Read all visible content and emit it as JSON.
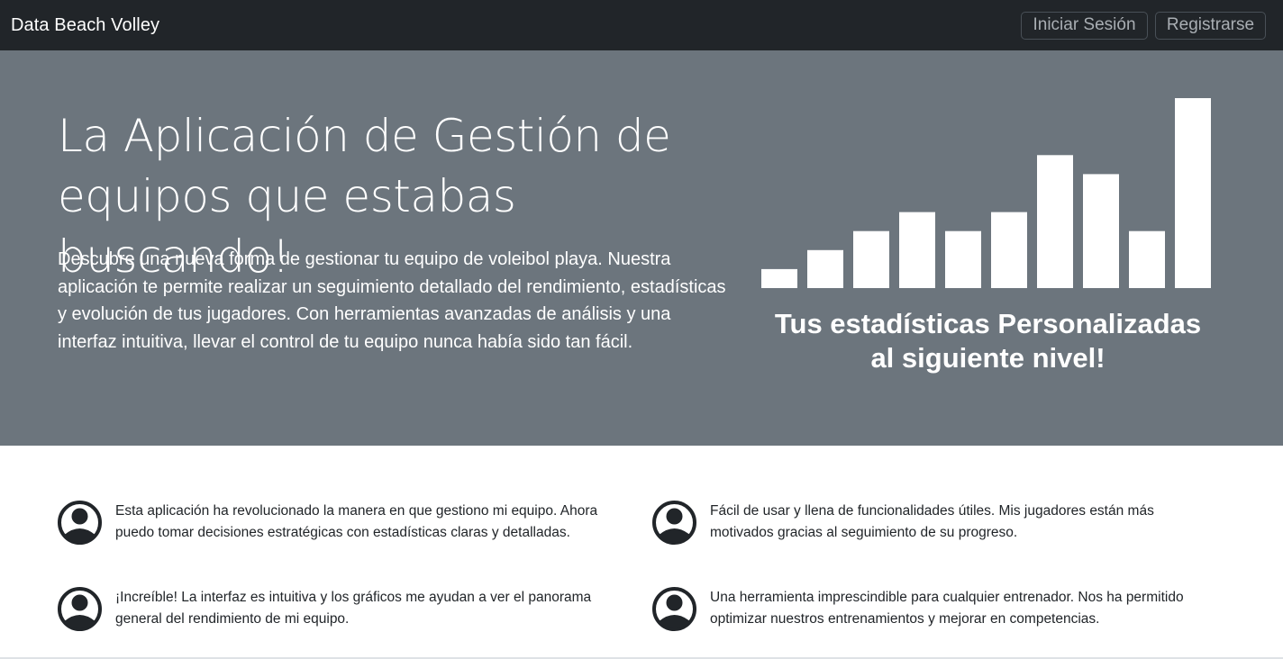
{
  "navbar": {
    "brand": "Data Beach Volley",
    "login_label": "Iniciar Sesión",
    "register_label": "Registrarse"
  },
  "hero": {
    "title": "La Aplicación de Gestión de equipos que estabas buscando!",
    "description": "Descubre una nueva forma de gestionar tu equipo de voleibol playa. Nuestra aplicación te permite realizar un seguimiento detallado del rendimiento, estadísticas y evolución de tus jugadores. Con herramientas avanzadas de análisis y una interfaz intuitiva, llevar el control de tu equipo nunca había sido tan fácil.",
    "chart_caption": "Tus estadísticas Personalizadas al siguiente nivel!"
  },
  "chart_data": {
    "type": "bar",
    "values": [
      1,
      2,
      3,
      4,
      3,
      4,
      7,
      6,
      3,
      10
    ],
    "ylim": [
      0,
      10
    ],
    "grid": false,
    "bar_color": "#ffffff"
  },
  "testimonials": [
    {
      "icon": "user-avatar-icon",
      "text": "Esta aplicación ha revolucionado la manera en que gestiono mi equipo. Ahora puedo tomar decisiones estratégicas con estadísticas claras y detalladas."
    },
    {
      "icon": "user-avatar-icon",
      "text": "Fácil de usar y llena de funcionalidades útiles. Mis jugadores están más motivados gracias al seguimiento de su progreso."
    },
    {
      "icon": "user-avatar-icon",
      "text": "¡Increíble! La interfaz es intuitiva y los gráficos me ayudan a ver el panorama general del rendimiento de mi equipo."
    },
    {
      "icon": "user-avatar-icon",
      "text": "Una herramienta imprescindible para cualquier entrenador. Nos ha permitido optimizar nuestros entrenamientos y mejorar en competencias."
    }
  ],
  "colors": {
    "navbar_bg": "#212529",
    "hero_bg": "#6c757d",
    "text_dark": "#212529"
  }
}
